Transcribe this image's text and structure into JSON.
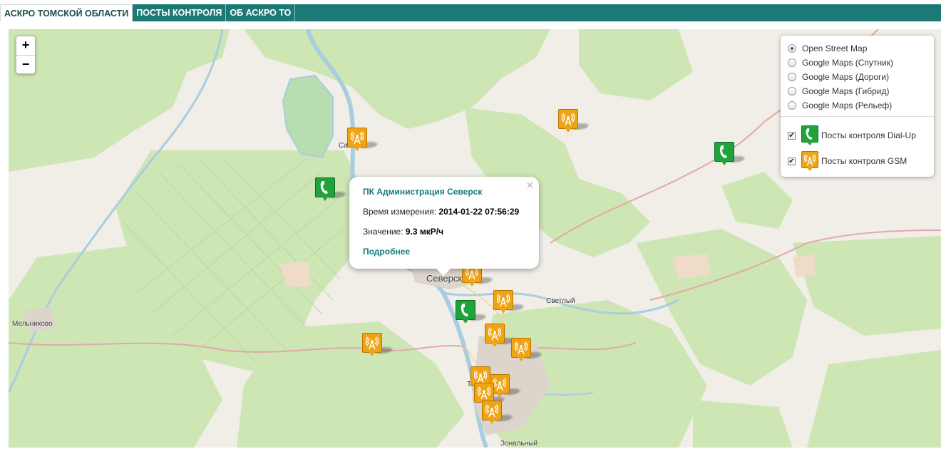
{
  "nav": {
    "tabs": [
      {
        "label": "АСКРО ТОМСКОЙ ОБЛАСТИ",
        "active": true
      },
      {
        "label": "ПОСТЫ КОНТРОЛЯ",
        "active": false
      },
      {
        "label": "ОБ АСКРО ТО",
        "active": false
      }
    ]
  },
  "map": {
    "zoom_in": "+",
    "zoom_out": "−",
    "places": {
      "seversk": "Северск",
      "svetly": "Светлый",
      "melnikovo": "Мельниково",
      "samus": "Сам",
      "zonalny": "Зональный",
      "tomsk_fragment": "То"
    },
    "colors": {
      "gsm_marker": "#f0a313",
      "dialup_marker": "#20a33a",
      "forest": "#cde6b4",
      "river": "#a8cde0",
      "accent": "#1c7a76"
    }
  },
  "popup": {
    "title": "ПК Администрация Северск",
    "time_label": "Время измерения:",
    "time_value": "2014-01-22 07:56:29",
    "value_label": "Значение:",
    "value_value": "9.3 мкР/ч",
    "more_link": "Подробнее",
    "close": "×"
  },
  "layers": {
    "base": [
      {
        "label": "Open Street Map",
        "selected": true
      },
      {
        "label": "Google Maps (Спутник)",
        "selected": false
      },
      {
        "label": "Google Maps (Дороги)",
        "selected": false
      },
      {
        "label": "Google Maps (Гибрид)",
        "selected": false
      },
      {
        "label": "Google Maps (Рельеф)",
        "selected": false
      }
    ],
    "overlays": [
      {
        "label": "Посты контроля Dial-Up",
        "checked": true,
        "icon": "phone-icon"
      },
      {
        "label": "Посты контроля GSM",
        "checked": true,
        "icon": "antenna-icon"
      }
    ],
    "check_mark": "✔"
  }
}
